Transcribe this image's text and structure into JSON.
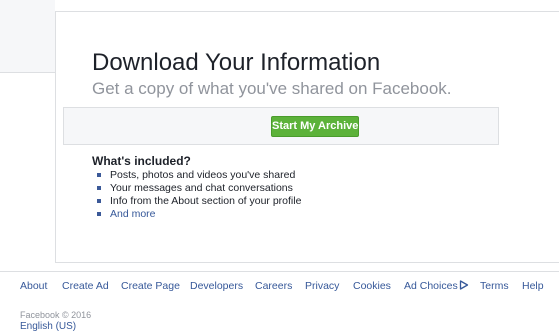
{
  "card": {
    "title": "Download Your Information",
    "subtitle": "Get a copy of what you've shared on Facebook.",
    "button_label": "Start My Archive",
    "button_color": "#5cb23a",
    "included_heading": "What's included?",
    "included_items": [
      "Posts, photos and videos you've shared",
      "Your messages and chat conversations",
      "Info from the About section of your profile"
    ],
    "and_more_label": "And more"
  },
  "footer": {
    "links": [
      "About",
      "Create Ad",
      "Create Page",
      "Developers",
      "Careers",
      "Privacy",
      "Cookies",
      "Ad Choices",
      "Terms",
      "Help"
    ],
    "adchoices_icon": "adchoices-triangle-icon",
    "copyright": "Facebook © 2016",
    "language": "English (US)",
    "link_color": "#365899"
  }
}
